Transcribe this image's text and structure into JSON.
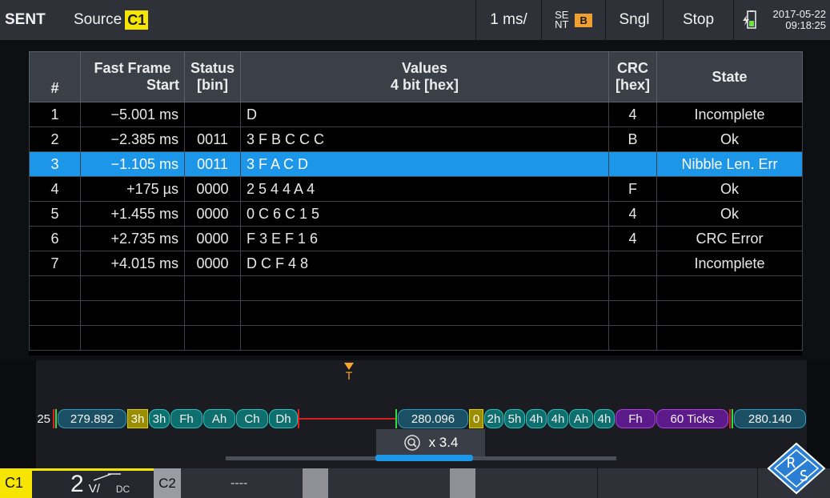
{
  "topbar": {
    "protocol": "SENT",
    "source_label": "Source",
    "source_channel": "C1",
    "timebase": "1 ms/",
    "trigger_type_line1": "SE",
    "trigger_type_line2": "NT",
    "trigger_badge": "B",
    "mode": "Sngl",
    "run_state": "Stop",
    "date": "2017-05-22",
    "time": "09:18:25"
  },
  "table": {
    "headers": {
      "index": "#",
      "start_line1": "Fast Frame",
      "start_line2": "Start",
      "status_line1": "Status",
      "status_line2": "[bin]",
      "values_line1": "Values",
      "values_line2": "4 bit [hex]",
      "crc_line1": "CRC",
      "crc_line2": "[hex]",
      "state": "State"
    },
    "rows": [
      {
        "index": "1",
        "start": "−5.001 ms",
        "status": "",
        "values": "D",
        "crc": "4",
        "state": "Incomplete"
      },
      {
        "index": "2",
        "start": "−2.385 ms",
        "status": "0011",
        "values": "3 F B C C C",
        "crc": "B",
        "state": "Ok"
      },
      {
        "index": "3",
        "start": "−1.105 ms",
        "status": "0011",
        "values": "3 F A C D",
        "crc": "",
        "state": "Nibble Len. Err"
      },
      {
        "index": "4",
        "start": "+175 µs",
        "status": "0000",
        "values": "2 5 4 4 A 4",
        "crc": "F",
        "state": "Ok"
      },
      {
        "index": "5",
        "start": "+1.455 ms",
        "status": "0000",
        "values": "0 C 6 C 1 5",
        "crc": "4",
        "state": "Ok"
      },
      {
        "index": "6",
        "start": "+2.735 ms",
        "status": "0000",
        "values": "F 3 E F 1 6",
        "crc": "4",
        "state": "CRC Error"
      },
      {
        "index": "7",
        "start": "+4.015 ms",
        "status": "0000",
        "values": "D C F 4 8",
        "crc": "",
        "state": "Incomplete"
      }
    ],
    "selected_index": "3"
  },
  "waveform": {
    "trigger_marker": "T",
    "bus": {
      "s0": "25",
      "s1": "279.892",
      "s2": "3h",
      "s3": "3h",
      "s4": "Fh",
      "s5": "Ah",
      "s6": "Ch",
      "s7": "Dh",
      "s8": "280.096",
      "s9": "0",
      "s10": "2h",
      "s11": "5h",
      "s12": "4h",
      "s13": "4h",
      "s14": "Ah",
      "s15": "4h",
      "s16": "Fh",
      "s17": "60 Ticks",
      "s18": "280.140"
    },
    "zoom_label": "x 3.4",
    "zoom_position_fraction": 0.5
  },
  "bottombar": {
    "c1_label": "C1",
    "c1_scale": "2",
    "c1_unit": "V/",
    "c1_coupling": "DC",
    "c2_label": "C2",
    "c2_value": "----"
  },
  "colors": {
    "c1_yellow": "#f6e500",
    "selection_blue": "#1c96e8",
    "trigger_orange": "#f7a631",
    "logo_blue": "#2a7fd4"
  }
}
